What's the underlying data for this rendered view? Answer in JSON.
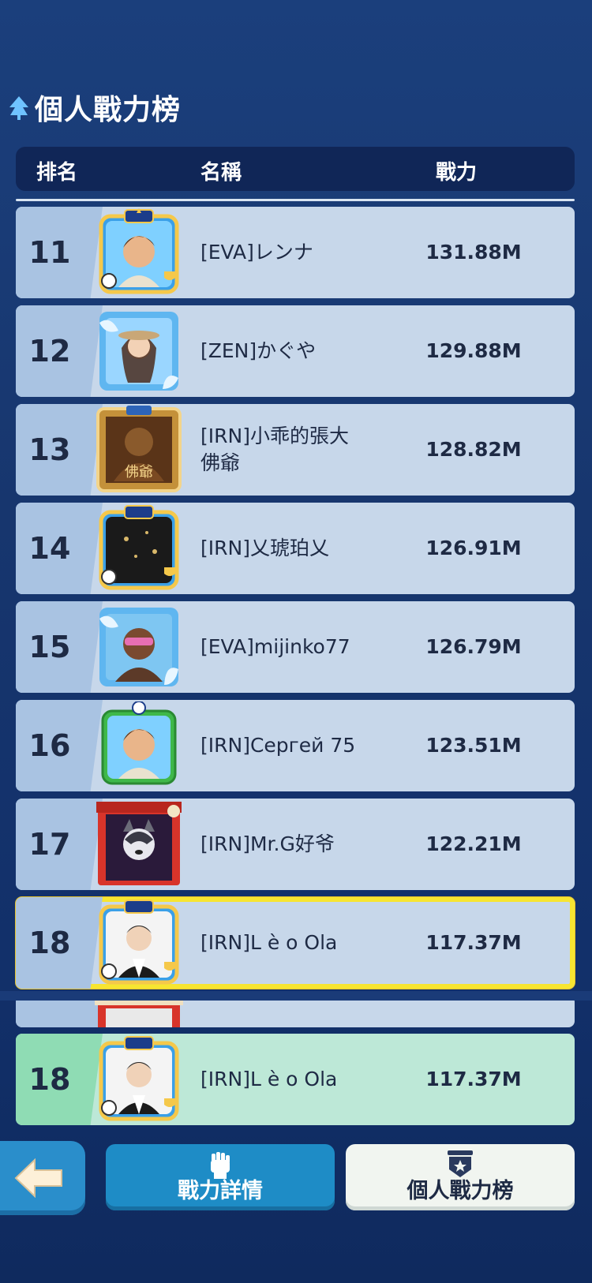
{
  "page_title": "個人戰力榜",
  "header": {
    "rank": "排名",
    "name": "名稱",
    "power": "戰力"
  },
  "rows": [
    {
      "rank": "11",
      "name": "[EVA]レンナ",
      "power": "131.88M",
      "avatar_icon": "cartoon-man-avatar-icon"
    },
    {
      "rank": "12",
      "name": "[ZEN]かぐや",
      "power": "129.88M",
      "avatar_icon": "girl-photo-avatar-icon"
    },
    {
      "rank": "13",
      "name": "[IRN]小乖的張大佛爺",
      "power": "128.82M",
      "avatar_icon": "gold-buddha-avatar-icon"
    },
    {
      "rank": "14",
      "name": "[IRN]乂琥珀乂",
      "power": "126.91M",
      "avatar_icon": "dark-calligraphy-avatar-icon"
    },
    {
      "rank": "15",
      "name": "[EVA]mijinko77",
      "power": "126.79M",
      "avatar_icon": "sunglasses-man-avatar-icon"
    },
    {
      "rank": "16",
      "name": "[IRN]Сергей 75",
      "power": "123.51M",
      "avatar_icon": "cartoon-man-green-frame-avatar-icon"
    },
    {
      "rank": "17",
      "name": "[IRN]Mr.G好爷",
      "power": "122.21M",
      "avatar_icon": "husky-dog-avatar-icon"
    },
    {
      "rank": "18",
      "name": "[IRN]L è o Ola",
      "power": "117.37M",
      "avatar_icon": "young-man-photo-avatar-icon"
    }
  ],
  "my_row": {
    "rank": "18",
    "name": "[IRN]L è o Ola",
    "power": "117.37M",
    "avatar_icon": "young-man-photo-avatar-icon"
  },
  "buttons": {
    "power_details": "戰力詳情",
    "personal_ranking": "個人戰力榜"
  },
  "colors": {
    "background": "#17366e",
    "row": "#c7d7ea",
    "my_row": "#bde8d7",
    "highlight_border": "#f7e531",
    "button_blue": "#1e8cc6"
  }
}
